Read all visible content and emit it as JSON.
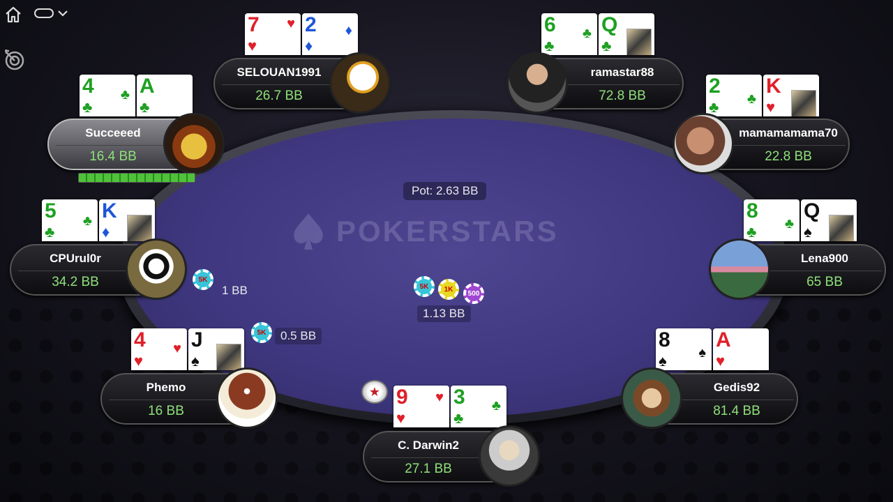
{
  "pot": {
    "label": "Pot: 2.63 BB"
  },
  "center_bet": {
    "label": "1.13 BB",
    "chips": [
      "5K",
      "1K",
      "500"
    ]
  },
  "logo": {
    "text": "POKERSTARS"
  },
  "players": [
    {
      "id": "selouan",
      "name": "SELOUAN1991",
      "stack": "26.7 BB",
      "cards": [
        {
          "rank": "7",
          "suit": "♥",
          "color": "red"
        },
        {
          "rank": "2",
          "suit": "♦",
          "color": "blue"
        }
      ]
    },
    {
      "id": "ramastar",
      "name": "ramastar88",
      "stack": "72.8 BB",
      "cards": [
        {
          "rank": "6",
          "suit": "♣",
          "color": "green"
        },
        {
          "rank": "Q",
          "suit": "♣",
          "color": "green"
        }
      ]
    },
    {
      "id": "succeeed",
      "name": "Succeeed",
      "stack": "16.4 BB",
      "active": true,
      "timer_fraction": 1.0,
      "cards": [
        {
          "rank": "4",
          "suit": "♣",
          "color": "green"
        },
        {
          "rank": "A",
          "suit": "♣",
          "color": "green"
        }
      ]
    },
    {
      "id": "mamama",
      "name": "mamamamama70",
      "stack": "22.8 BB",
      "cards": [
        {
          "rank": "2",
          "suit": "♣",
          "color": "green"
        },
        {
          "rank": "K",
          "suit": "♥",
          "color": "red"
        }
      ]
    },
    {
      "id": "cpurul",
      "name": "CPUrul0r",
      "stack": "34.2 BB",
      "bet": "1 BB",
      "bet_chip": "5K",
      "cards": [
        {
          "rank": "5",
          "suit": "♣",
          "color": "green"
        },
        {
          "rank": "K",
          "suit": "♦",
          "color": "blue"
        }
      ]
    },
    {
      "id": "lena",
      "name": "Lena900",
      "stack": "65 BB",
      "cards": [
        {
          "rank": "8",
          "suit": "♣",
          "color": "green"
        },
        {
          "rank": "Q",
          "suit": "♠",
          "color": "black"
        }
      ]
    },
    {
      "id": "phemo",
      "name": "Phemo",
      "stack": "16 BB",
      "bet": "0.5 BB",
      "bet_chip": "5K",
      "cards": [
        {
          "rank": "4",
          "suit": "♥",
          "color": "red"
        },
        {
          "rank": "J",
          "suit": "♠",
          "color": "black"
        }
      ]
    },
    {
      "id": "gedis",
      "name": "Gedis92",
      "stack": "81.4 BB",
      "cards": [
        {
          "rank": "8",
          "suit": "♠",
          "color": "black"
        },
        {
          "rank": "A",
          "suit": "♥",
          "color": "red"
        }
      ]
    },
    {
      "id": "darwin",
      "name": "C. Darwin2",
      "stack": "27.1 BB",
      "dealer": true,
      "cards": [
        {
          "rank": "9",
          "suit": "♥",
          "color": "red"
        },
        {
          "rank": "3",
          "suit": "♣",
          "color": "green"
        }
      ]
    }
  ],
  "icons": {
    "home": "home-icon",
    "menu": "menu-pill-icon",
    "target": "target-icon",
    "dealer": "dealer-button-icon"
  }
}
